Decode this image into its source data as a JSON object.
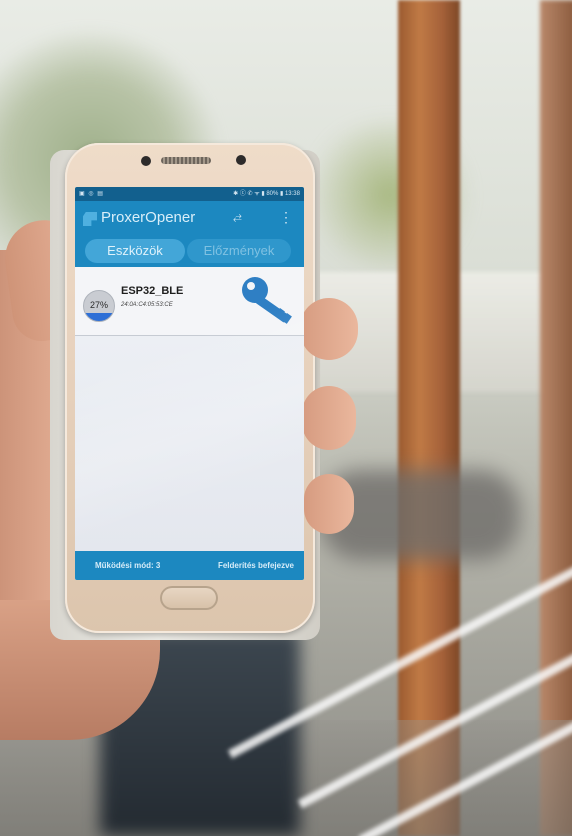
{
  "phone": {
    "status_bar": {
      "left_icons": "▣ ◎ ▤",
      "right_status": "✱ ⓒ ✆ ᯤ ▮ 80% ▮ 13:38"
    },
    "app_bar": {
      "title": "ProxerOpener",
      "action_icon": "scan-icon",
      "menu_icon": "overflow-menu-icon"
    },
    "tabs": [
      {
        "label": "Eszközök",
        "active": true
      },
      {
        "label": "Előzmények",
        "active": false
      }
    ],
    "devices": [
      {
        "name": "ESP32_BLE",
        "mac": "24:0A:C4:05:53:CE",
        "battery_label": "27%",
        "battery_level": 0.27,
        "icon": "key-icon"
      }
    ],
    "footer": {
      "mode": "Működési mód: 3",
      "status": "Felderítés befejezve"
    }
  },
  "colors": {
    "app_blue": "#1c88c0",
    "status_blue": "#12608e",
    "key_blue": "#2f7fc4"
  }
}
